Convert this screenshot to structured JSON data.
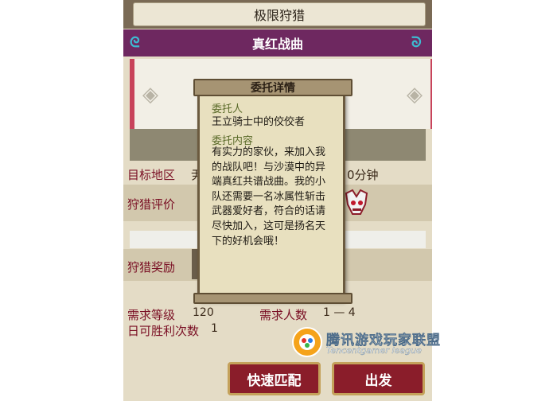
{
  "header": {
    "title": "极限狩猎"
  },
  "quest": {
    "name": "真红战曲"
  },
  "fields": {
    "target_area_label": "目标地区",
    "target_area_value": "尹",
    "time_value": "0分钟",
    "hunt_rating_label": "狩猎评价",
    "hunt_reward_label": "狩猎奖励",
    "required_level_label": "需求等级",
    "required_level_value": "120",
    "required_players_label": "需求人数",
    "required_players_value": "1 — 4",
    "daily_wins_label": "日可胜利次数",
    "daily_wins_value": "1"
  },
  "popup": {
    "title": "委托详情",
    "client_label": "委托人",
    "client_value": "王立骑士中的佼佼者",
    "content_label": "委托内容",
    "content_lines": [
      "有实力的家伙，来加入我",
      "的战队吧！与沙漠中的异",
      "端真红共谱战曲。我的小",
      "队还需要一名冰属性斩击",
      "武器爱好者，符合的话请",
      "尽快加入，这可是扬名天",
      "下的好机会哦！"
    ]
  },
  "buttons": {
    "quick_match": "快速匹配",
    "depart": "出发"
  },
  "watermark": {
    "name": "腾讯游戏玩家联盟",
    "sub": "Tencentgamer league"
  },
  "colors": {
    "accent": "#6e2860",
    "button": "#8a1d2a",
    "label": "#7a0f24"
  },
  "icons": {
    "swirl": "swirl-ornament-icon",
    "logo": "tencent-league-logo-icon"
  }
}
